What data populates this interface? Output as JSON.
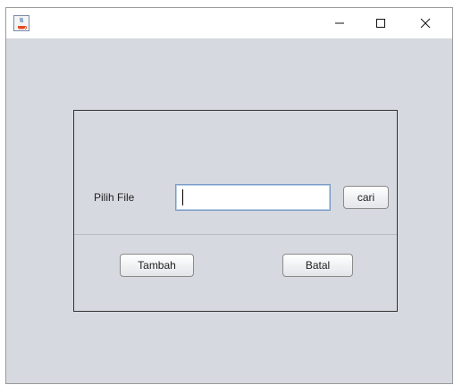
{
  "window": {
    "app_icon": "java-cup-icon",
    "controls": {
      "minimize": "–",
      "maximize": "☐",
      "close": "✕"
    }
  },
  "form": {
    "label": "Pilih File",
    "file_value": "",
    "browse_label": "cari",
    "add_label": "Tambah",
    "cancel_label": "Batal"
  }
}
